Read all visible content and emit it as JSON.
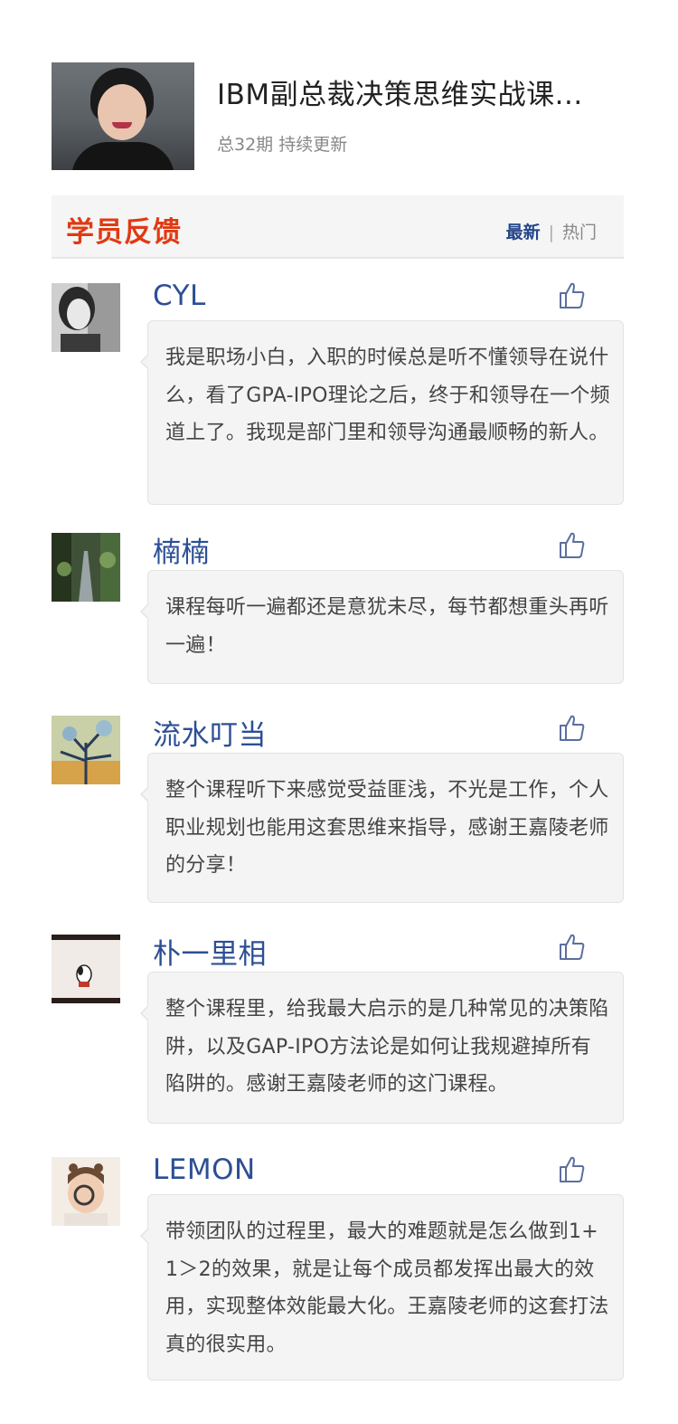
{
  "course": {
    "title": "IBM副总裁决策思维实战课...",
    "subtitle": "总32期 持续更新"
  },
  "section": {
    "title": "学员反馈",
    "tab_latest": "最新",
    "tab_separator": "|",
    "tab_hot": "热门"
  },
  "reviews": [
    {
      "name": "CYL",
      "text": "我是职场小白，入职的时候总是听不懂领导在说什么，看了GPA-IPO理论之后，终于和领导在一个频道上了。我现是部门里和领导沟通最顺畅的新人。"
    },
    {
      "name": "楠楠",
      "text": "课程每听一遍都还是意犹未尽，每节都想重头再听一遍！"
    },
    {
      "name": "流水叮当",
      "text": "整个课程听下来感觉受益匪浅，不光是工作，个人职业规划也能用这套思维来指导，感谢王嘉陵老师的分享！"
    },
    {
      "name": "朴一里相",
      "text": "整个课程里，给我最大启示的是几种常见的决策陷阱，以及GAP-IPO方法论是如何让我规避掉所有陷阱的。感谢王嘉陵老师的这门课程。"
    },
    {
      "name": "LEMON",
      "text": "带领团队的过程里，最大的难题就是怎么做到1+1＞2的效果，就是让每个成员都发挥出最大的效用，实现整体效能最大化。王嘉陵老师的这套打法真的很实用。"
    }
  ],
  "icons": {
    "like": "thumbs-up-icon"
  },
  "colors": {
    "accent_red": "#e03a12",
    "name_blue": "#2c4f94",
    "tab_blue": "#24458a"
  }
}
